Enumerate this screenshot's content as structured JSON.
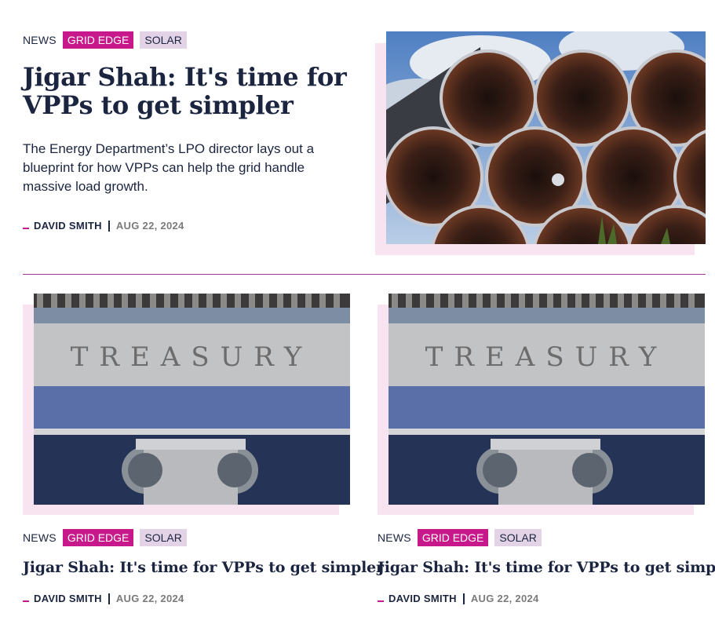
{
  "hero": {
    "tags": {
      "news": "NEWS",
      "grid_edge": "GRID EDGE",
      "solar": "SOLAR"
    },
    "title": "Jigar Shah: It's time for VPPs to get simpler",
    "dek": "The Energy Department’s LPO director lays out a blueprint for how VPPs can help the grid handle massive load growth.",
    "author": "DAVID SMITH",
    "date": "AUG 22, 2024",
    "image": "pipes-photo"
  },
  "cards": [
    {
      "tags": {
        "news": "NEWS",
        "grid_edge": "GRID EDGE",
        "solar": "SOLAR"
      },
      "title": "Jigar Shah: It's time for VPPs to get simpler",
      "author": "DAVID SMITH",
      "date": "AUG 22, 2024",
      "image_text": "TREASURY"
    },
    {
      "tags": {
        "news": "NEWS",
        "grid_edge": "GRID EDGE",
        "solar": "SOLAR"
      },
      "title": "Jigar Shah: It's time for VPPs to get simpler",
      "author": "DAVID SMITH",
      "date": "AUG 22, 2024",
      "image_text": "TREASURY"
    }
  ],
  "colors": {
    "accent": "#c8198c",
    "tag_bg": "#e3d3e6",
    "text": "#1b2540",
    "shadow": "#f8e3f1"
  }
}
